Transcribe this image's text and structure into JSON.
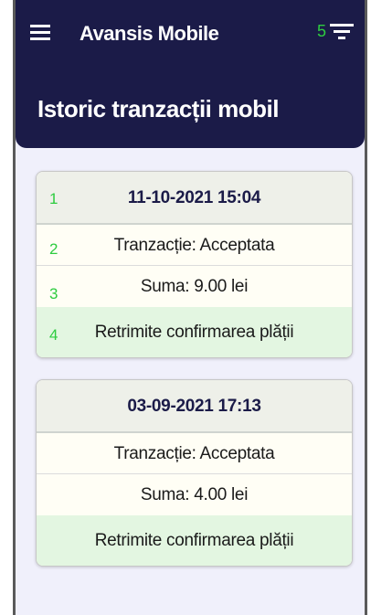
{
  "app": {
    "title": "Avansis Mobile",
    "filter_count": "5",
    "colors": {
      "header_bg": "#1b1b48",
      "accent_green": "#2ecc40",
      "resend_bg": "#e3f6e1",
      "date_bg": "#eef0e9"
    },
    "icons": {
      "menu": "hamburger-menu-icon",
      "filter": "filter-icon"
    }
  },
  "page": {
    "title": "Istoric tranzacții mobil"
  },
  "transactions": [
    {
      "date": "11-10-2021 15:04",
      "status": "Tranzacție: Acceptata",
      "amount": "Suma: 9.00 lei",
      "action": "Retrimite confirmarea plății",
      "markers": [
        "1",
        "2",
        "3",
        "4"
      ]
    },
    {
      "date": "03-09-2021 17:13",
      "status": "Tranzacție: Acceptata",
      "amount": "Suma: 4.00 lei",
      "action": "Retrimite confirmarea plății"
    }
  ]
}
